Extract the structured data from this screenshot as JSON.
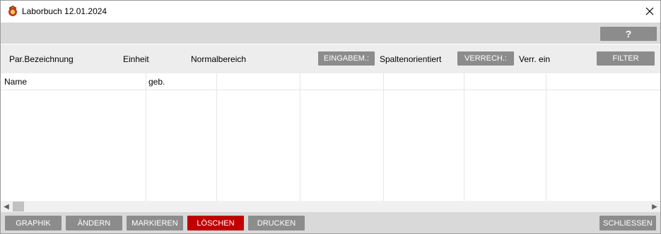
{
  "window": {
    "title": "Laborbuch 12.01.2024"
  },
  "help": {
    "label": "?"
  },
  "header": {
    "par_bezeichnung": "Par.Bezeichnung",
    "einheit": "Einheit",
    "normalbereich": "Normalbereich",
    "eingabem_button": "EINGABEM.:",
    "eingabem_value": "Spaltenorientiert",
    "verrech_button": "VERRECH.:",
    "verrech_value": "Verr. ein",
    "filter_button": "FILTER"
  },
  "table": {
    "columns": [
      "Name",
      "geb.",
      "",
      "",
      "",
      "",
      ""
    ]
  },
  "scrollbar": {
    "left_arrow": "◀",
    "right_arrow": "▶"
  },
  "buttons": {
    "graphik": "GRAPHIK",
    "aendern": "ÄNDERN",
    "markieren": "MARKIEREN",
    "loeschen": "LÖSCHEN",
    "drucken": "DRUCKEN",
    "schliessen": "SCHLIESSEN"
  },
  "colors": {
    "button_gray": "#8c8c8c",
    "danger_red": "#c00000",
    "bar_gray": "#d9d9d9",
    "header_gray": "#ededed"
  }
}
